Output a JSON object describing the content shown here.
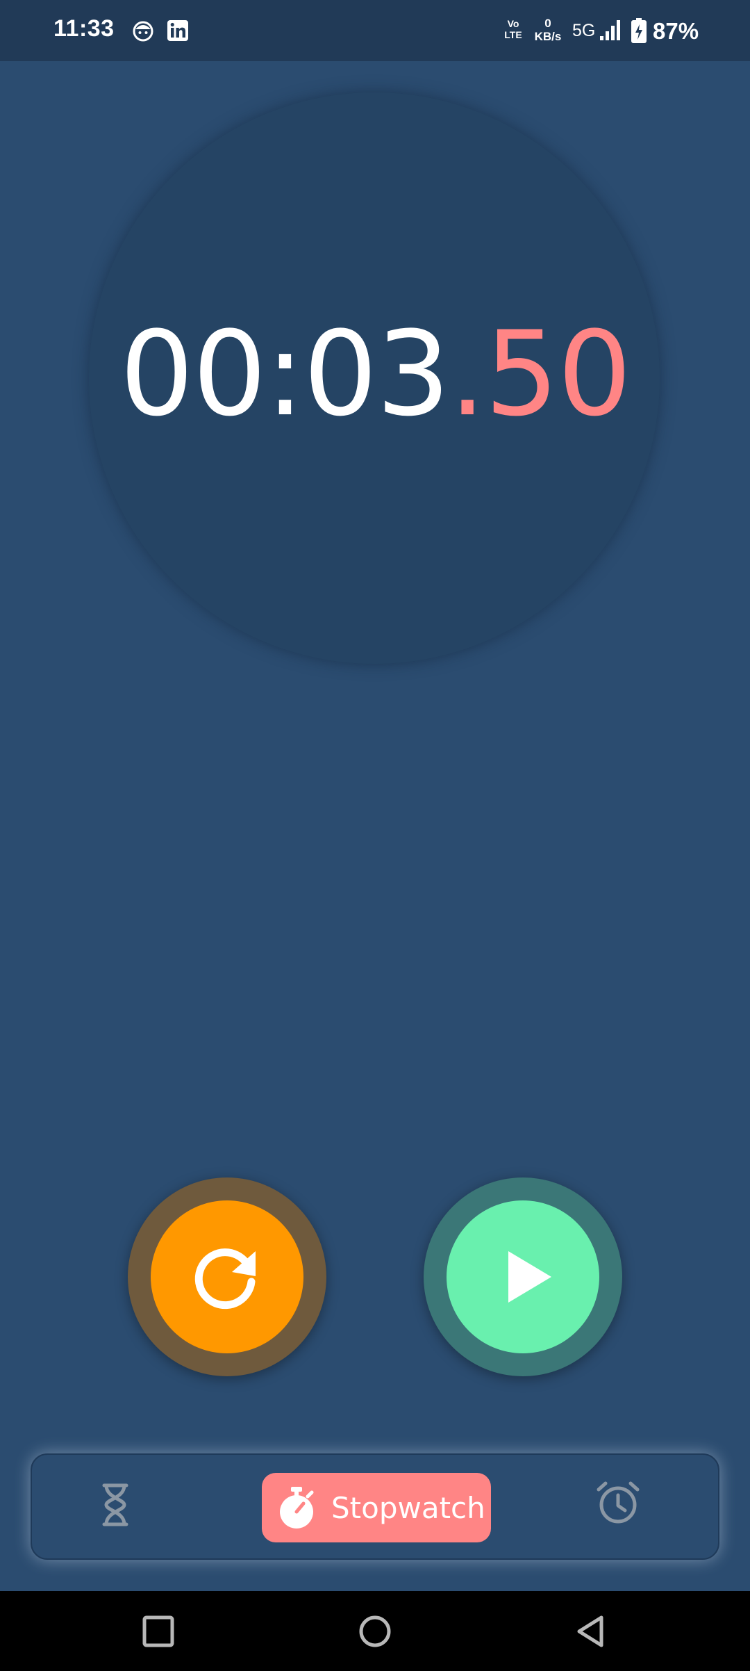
{
  "status_bar": {
    "time": "11:33",
    "volte": [
      "Vo",
      "LTE"
    ],
    "net_speed_value": "0",
    "net_speed_unit": "KB/s",
    "network": "5G",
    "battery": "87%",
    "icons": [
      "face-notification-icon",
      "linkedin-icon",
      "signal-icon",
      "battery-charging-icon"
    ]
  },
  "stopwatch": {
    "time_main": "00:03",
    "time_fraction": ".50",
    "colors": {
      "main_text": "#ffffff",
      "fraction_text": "#ff8585"
    }
  },
  "controls": {
    "reset": {
      "icon": "reset-icon",
      "color": "#ff9800"
    },
    "play": {
      "icon": "play-icon",
      "color": "#69f0ae"
    }
  },
  "bottom_nav": {
    "items": [
      {
        "id": "timer",
        "icon": "hourglass-icon",
        "label": ""
      },
      {
        "id": "stopwatch",
        "icon": "stopwatch-icon",
        "label": "Stopwatch",
        "active": true,
        "color": "#ff8585"
      },
      {
        "id": "alarm",
        "icon": "alarm-clock-icon",
        "label": ""
      }
    ]
  },
  "system_nav": {
    "buttons": [
      "recents-icon",
      "home-icon",
      "back-icon"
    ]
  }
}
